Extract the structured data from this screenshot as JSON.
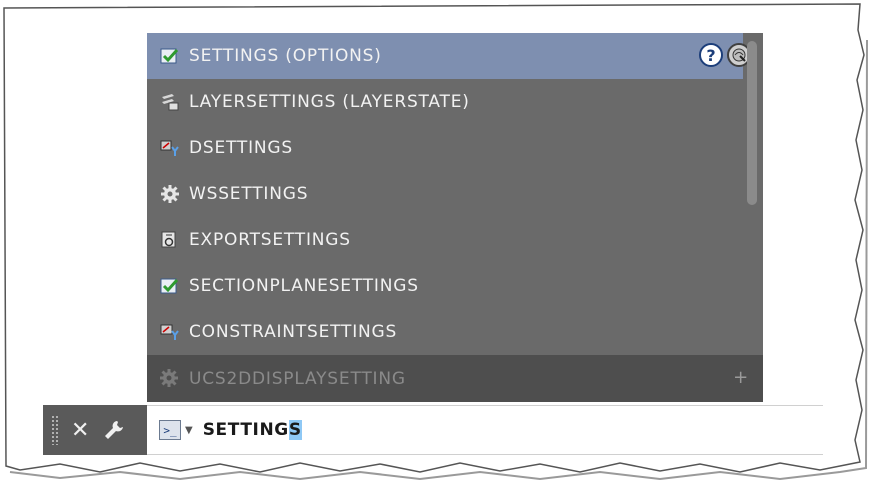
{
  "autocomplete": {
    "items": [
      {
        "label": "SETTINGS (OPTIONS)",
        "icon": "checkbox-icon",
        "selected": true
      },
      {
        "label": "LAYERSETTINGS (LAYERSTATE)",
        "icon": "layers-icon",
        "selected": false
      },
      {
        "label": "DSETTINGS",
        "icon": "drafting-settings-icon",
        "selected": false
      },
      {
        "label": "WSSETTINGS",
        "icon": "gear-icon",
        "selected": false
      },
      {
        "label": "EXPORTSETTINGS",
        "icon": "export-icon",
        "selected": false
      },
      {
        "label": "SECTIONPLANESETTINGS",
        "icon": "checkbox-icon",
        "selected": false
      },
      {
        "label": "CONSTRAINTSETTINGS",
        "icon": "constraint-icon",
        "selected": false
      }
    ],
    "footer_item": {
      "label": "UCS2DDISPLAYSETTING",
      "icon": "gear-icon"
    },
    "help_label": "?",
    "expand_label": "+"
  },
  "command_line": {
    "close_label": "✕",
    "prompt_label": ">_",
    "typed_prefix": "SETTING",
    "typed_highlight": "S"
  },
  "colors": {
    "popup_bg": "#6a6a6a",
    "selected_row": "#7e8fb0",
    "footer_bg": "#4e4e4e",
    "highlight": "#8ec8f5"
  }
}
